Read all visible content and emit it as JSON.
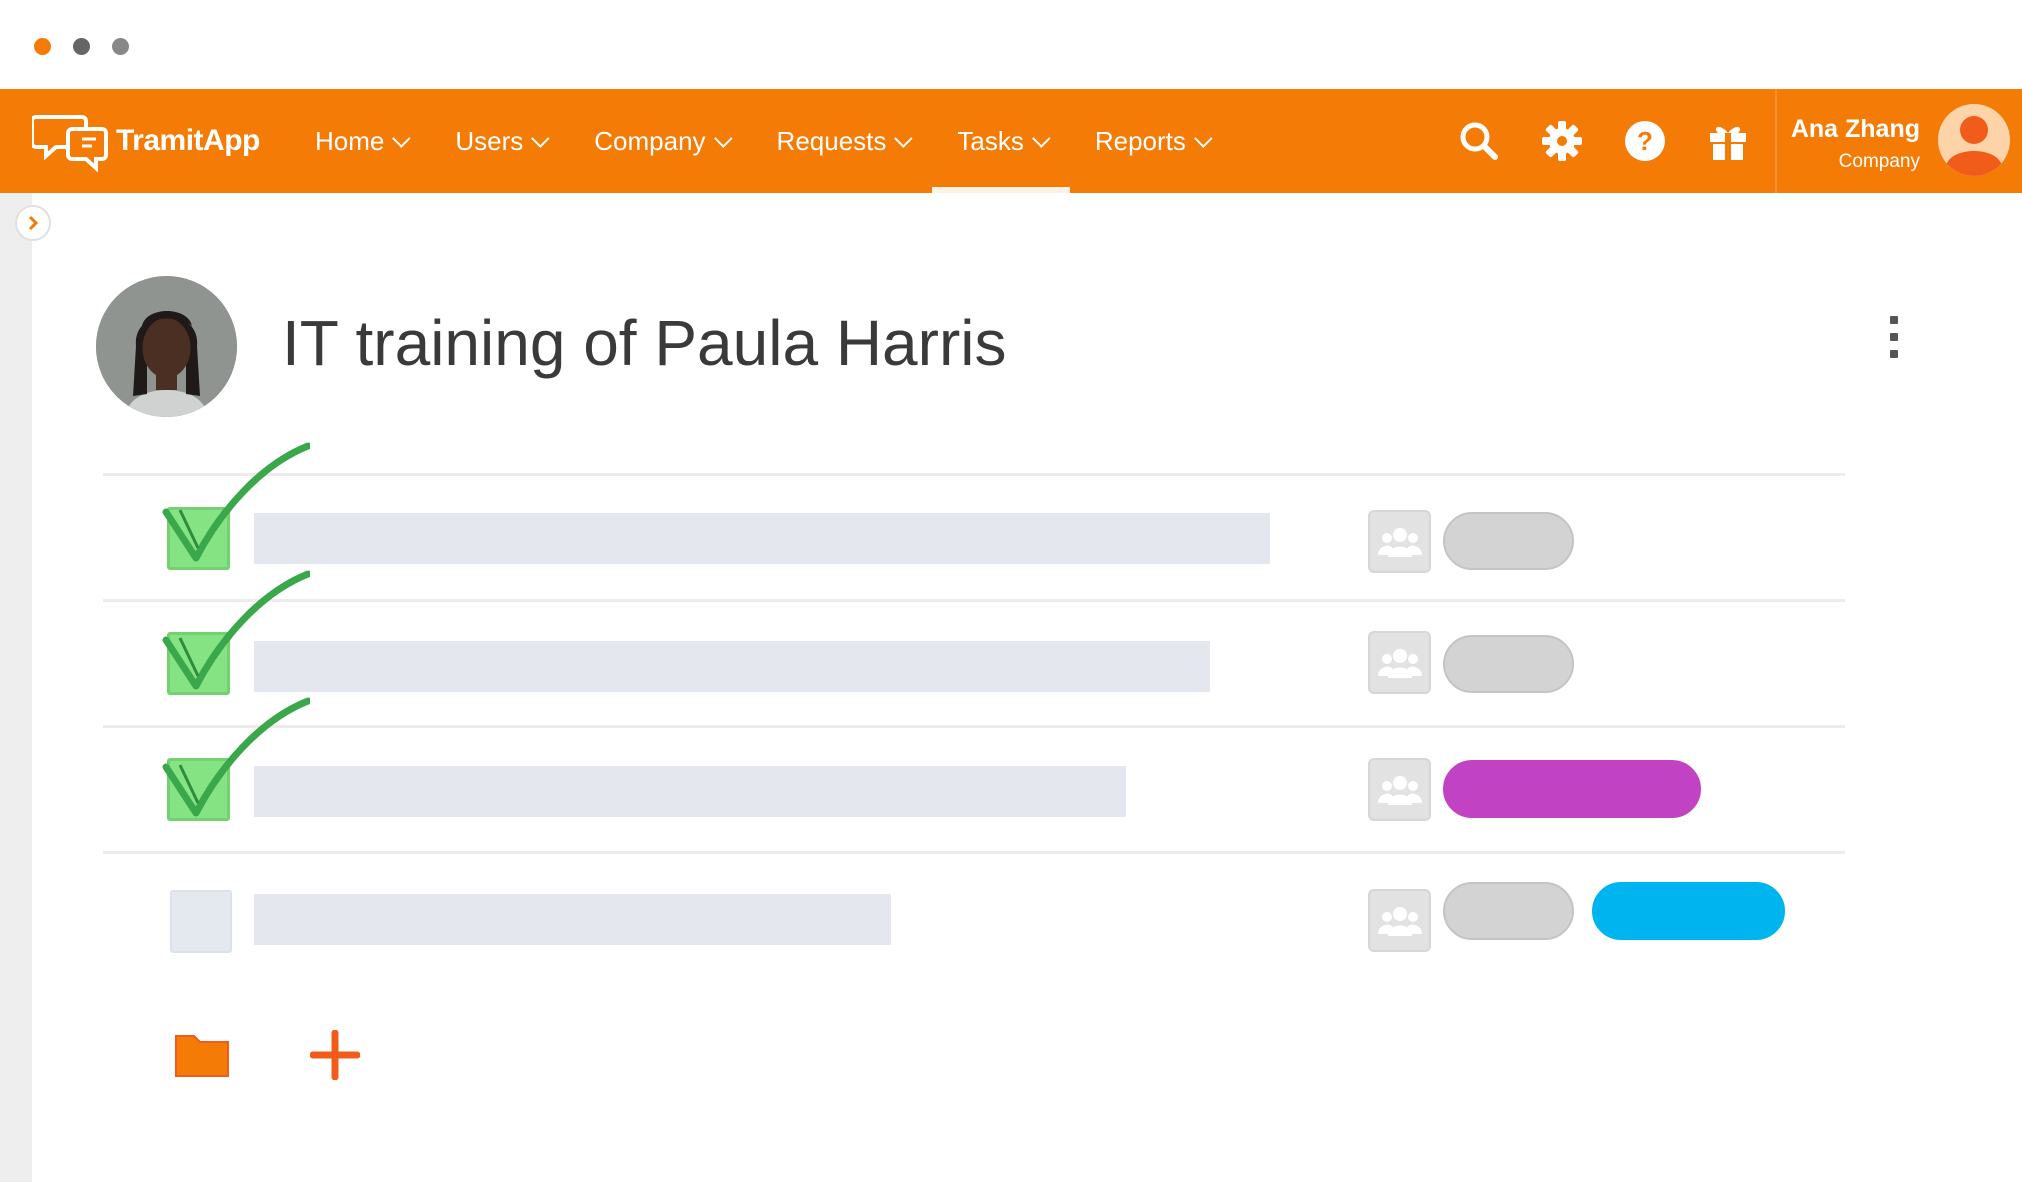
{
  "window": {
    "dots": [
      "#f47b06",
      "#666666",
      "#888888"
    ]
  },
  "navbar": {
    "background": "#f47b06",
    "logo": {
      "text": "TramitApp",
      "icon": "chat-bubbles-logo-icon"
    },
    "items": [
      {
        "label": "Home",
        "active": false
      },
      {
        "label": "Users",
        "active": false
      },
      {
        "label": "Company",
        "active": false
      },
      {
        "label": "Requests",
        "active": false
      },
      {
        "label": "Tasks",
        "active": true
      },
      {
        "label": "Reports",
        "active": false
      }
    ],
    "icons": [
      "search-icon",
      "gear-icon",
      "help-icon",
      "gift-icon"
    ],
    "user": {
      "name": "Ana Zhang",
      "company": "Company",
      "avatar": "user-avatar-icon"
    }
  },
  "page": {
    "title": "IT training of Paula Harris",
    "profile_photo": "profile-photo"
  },
  "tasks": [
    {
      "completed": true,
      "tag_colors": [
        "#d3d3d3"
      ]
    },
    {
      "completed": true,
      "tag_colors": [
        "#d3d3d3"
      ]
    },
    {
      "completed": true,
      "tag_colors": [
        "#c142c3"
      ]
    },
    {
      "completed": false,
      "tag_colors": [
        "#d3d3d3",
        "#00b4f0"
      ]
    }
  ],
  "footer_actions": {
    "folder": "folder-icon",
    "add": "add-icon"
  }
}
